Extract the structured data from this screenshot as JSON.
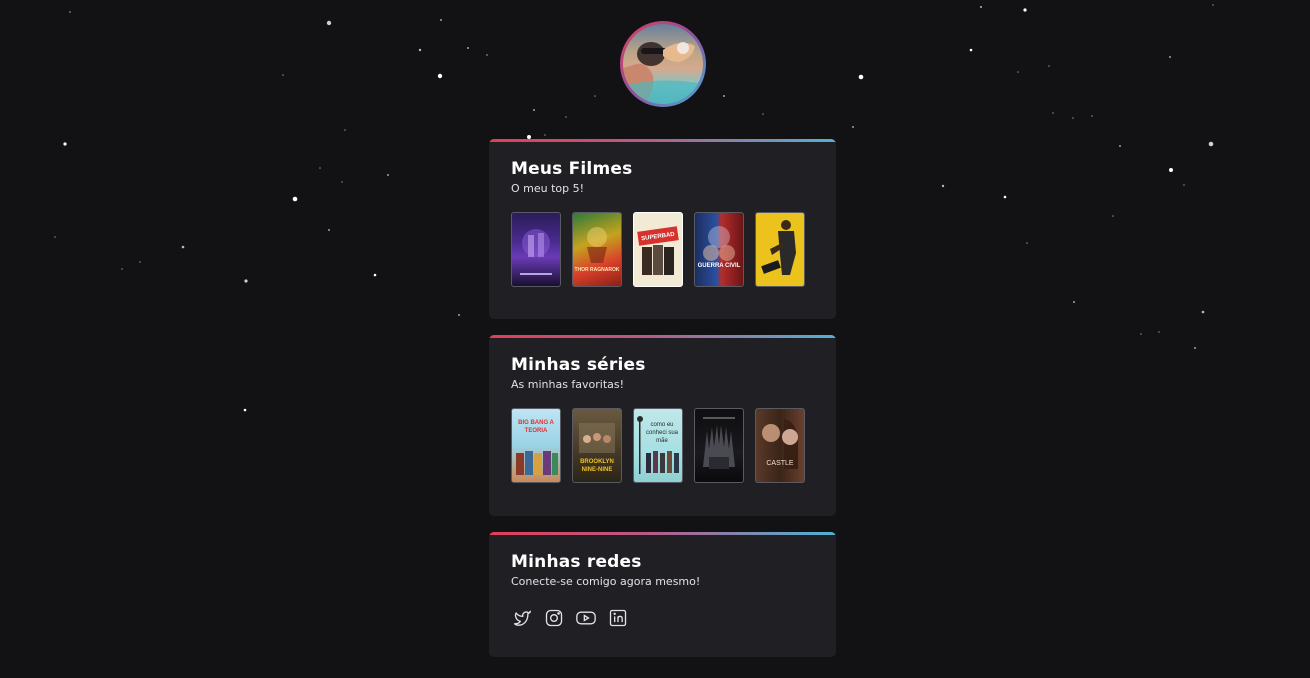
{
  "profile": {
    "avatar_icon": "profile-photo"
  },
  "colors": {
    "background": "#121214",
    "card": "#202024",
    "gradient_start": "#e23e57",
    "gradient_end": "#4fb2d6"
  },
  "movies": {
    "title": "Meus Filmes",
    "subtitle": "O meu top 5!",
    "posters": [
      {
        "name": "avengers-endgame",
        "caption": ""
      },
      {
        "name": "thor-ragnarok",
        "caption": "THOR RAGNAROK"
      },
      {
        "name": "superbad",
        "caption": "SUPERBAD"
      },
      {
        "name": "captain-america-civil-war",
        "caption": "GUERRA CIVIL"
      },
      {
        "name": "yellow-poster-movie",
        "caption": ""
      }
    ]
  },
  "series": {
    "title": "Minhas séries",
    "subtitle": "As minhas favoritas!",
    "posters": [
      {
        "name": "big-bang-theory",
        "caption": "BIG BANG A TEORIA"
      },
      {
        "name": "brooklyn-nine-nine",
        "caption": "BROOKLYN NINE-NINE"
      },
      {
        "name": "how-i-met-your-mother",
        "caption": "como eu conheci sua mãe"
      },
      {
        "name": "game-of-thrones",
        "caption": ""
      },
      {
        "name": "castle",
        "caption": "CASTLE"
      }
    ]
  },
  "social": {
    "title": "Minhas redes",
    "subtitle": "Conecte-se comigo agora mesmo!",
    "icons": [
      "twitter-icon",
      "instagram-icon",
      "youtube-icon",
      "linkedin-icon"
    ]
  }
}
